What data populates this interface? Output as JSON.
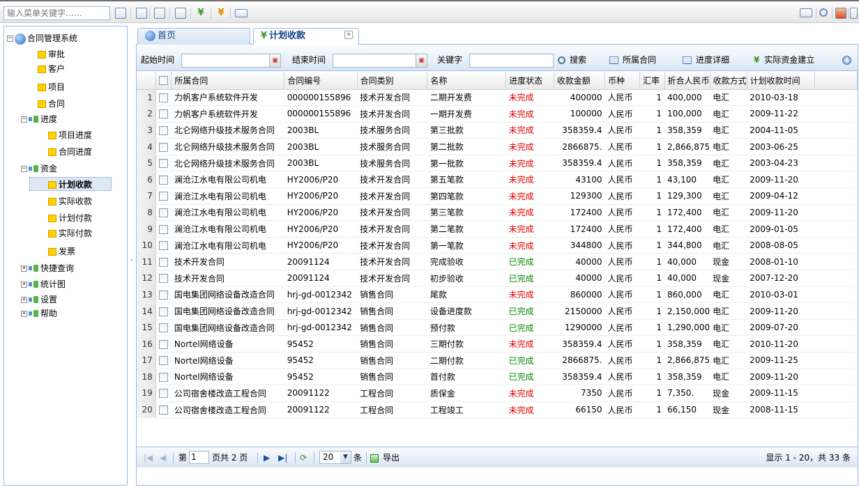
{
  "topbar": {
    "search_placeholder": "输入菜单关键字……",
    "icons": [
      "tree-expand-icon",
      "list-icon",
      "window-icon",
      "grid-icon",
      "yen-green-icon",
      "yen-orange-icon",
      "card-icon",
      "mail-icon",
      "search-icon",
      "save-icon",
      "layout-icon"
    ]
  },
  "tree": {
    "root": "合同管理系统",
    "items": [
      {
        "label": "审批",
        "level": 1
      },
      {
        "label": "客户",
        "level": 1
      },
      {
        "label": "项目",
        "level": 1
      },
      {
        "label": "合同",
        "level": 1
      },
      {
        "label": "进度",
        "level": 0,
        "expanded": true
      },
      {
        "label": "项目进度",
        "level": 1
      },
      {
        "label": "合同进度",
        "level": 1
      },
      {
        "label": "资金",
        "level": 0,
        "expanded": true
      },
      {
        "label": "计划收款",
        "level": 1,
        "selected": true
      },
      {
        "label": "实际收款",
        "level": 1
      },
      {
        "label": "计划付款",
        "level": 1
      },
      {
        "label": "实际付款",
        "level": 1
      },
      {
        "label": "发票",
        "level": 1
      },
      {
        "label": "快捷查询",
        "level": 0,
        "expanded": false
      },
      {
        "label": "统计图",
        "level": 0,
        "expanded": false
      },
      {
        "label": "设置",
        "level": 0,
        "expanded": false
      },
      {
        "label": "帮助",
        "level": 0,
        "expanded": false
      }
    ]
  },
  "tabs": {
    "home": "首页",
    "active": "计划收款"
  },
  "filter": {
    "start_label": "起始时间",
    "end_label": "结束时间",
    "keyword_label": "关键字",
    "search_btn": "搜索",
    "contract_btn": "所属合同",
    "progress_btn": "进度详细",
    "fund_btn": "实际资金建立"
  },
  "grid": {
    "columns": [
      "所属合同",
      "合同编号",
      "合同类别",
      "名称",
      "进度状态",
      "收款金额",
      "币种",
      "汇率",
      "折合人民币",
      "收款方式",
      "计划收款时间"
    ],
    "rows": [
      [
        "力帆客户系统软件开发",
        "000000155896",
        "技术开发合同",
        "二期开发费",
        "未完成",
        "400000",
        "人民币",
        "1",
        "400,000",
        "电汇",
        "2010-03-18"
      ],
      [
        "力帆客户系统软件开发",
        "000000155896",
        "技术开发合同",
        "一期开发费",
        "未完成",
        "100000",
        "人民币",
        "1",
        "100,000",
        "电汇",
        "2009-11-22"
      ],
      [
        "北仑网络升级技术服务合同",
        "2003BL",
        "技术服务合同",
        "第三批款",
        "未完成",
        "358359.4",
        "人民币",
        "1",
        "358,359",
        "电汇",
        "2004-11-05"
      ],
      [
        "北仑网络升级技术服务合同",
        "2003BL",
        "技术服务合同",
        "第二批款",
        "未完成",
        "2866875.",
        "人民币",
        "1",
        "2,866,875",
        "电汇",
        "2003-06-25"
      ],
      [
        "北仑网络升级技术服务合同",
        "2003BL",
        "技术服务合同",
        "第一批款",
        "未完成",
        "358359.4",
        "人民币",
        "1",
        "358,359",
        "电汇",
        "2003-04-23"
      ],
      [
        "澜沧江水电有限公司机电",
        "HY2006/P20",
        "技术开发合同",
        "第五笔款",
        "未完成",
        "43100",
        "人民币",
        "1",
        "43,100",
        "电汇",
        "2009-11-20"
      ],
      [
        "澜沧江水电有限公司机电",
        "HY2006/P20",
        "技术开发合同",
        "第四笔款",
        "未完成",
        "129300",
        "人民币",
        "1",
        "129,300",
        "电汇",
        "2009-04-12"
      ],
      [
        "澜沧江水电有限公司机电",
        "HY2006/P20",
        "技术开发合同",
        "第三笔款",
        "未完成",
        "172400",
        "人民币",
        "1",
        "172,400",
        "电汇",
        "2009-11-20"
      ],
      [
        "澜沧江水电有限公司机电",
        "HY2006/P20",
        "技术开发合同",
        "第二笔款",
        "未完成",
        "172400",
        "人民币",
        "1",
        "172,400",
        "电汇",
        "2009-01-05"
      ],
      [
        "澜沧江水电有限公司机电",
        "HY2006/P20",
        "技术开发合同",
        "第一笔款",
        "未完成",
        "344800",
        "人民币",
        "1",
        "344,800",
        "电汇",
        "2008-08-05"
      ],
      [
        "技术开发合同",
        "20091124",
        "技术开发合同",
        "完成验收",
        "已完成",
        "40000",
        "人民币",
        "1",
        "40,000",
        "现金",
        "2008-01-10"
      ],
      [
        "技术开发合同",
        "20091124",
        "技术开发合同",
        "初步验收",
        "已完成",
        "40000",
        "人民币",
        "1",
        "40,000",
        "现金",
        "2007-12-20"
      ],
      [
        "国电集团网络设备改造合同",
        "hrj-gd-0012342",
        "销售合同",
        "尾款",
        "未完成",
        "860000",
        "人民币",
        "1",
        "860,000",
        "电汇",
        "2010-03-01"
      ],
      [
        "国电集团网络设备改造合同",
        "hrj-gd-0012342",
        "销售合同",
        "设备进度款",
        "已完成",
        "2150000",
        "人民币",
        "1",
        "2,150,000",
        "电汇",
        "2009-11-20"
      ],
      [
        "国电集团网络设备改造合同",
        "hrj-gd-0012342",
        "销售合同",
        "预付款",
        "已完成",
        "1290000",
        "人民币",
        "1",
        "1,290,000",
        "电汇",
        "2009-07-20"
      ],
      [
        "Nortel网络设备",
        "95452",
        "销售合同",
        "三期付款",
        "未完成",
        "358359.4",
        "人民币",
        "1",
        "358,359",
        "电汇",
        "2010-11-20"
      ],
      [
        "Nortel网络设备",
        "95452",
        "销售合同",
        "二期付款",
        "已完成",
        "2866875.",
        "人民币",
        "1",
        "2,866,875",
        "电汇",
        "2009-11-25"
      ],
      [
        "Nortel网络设备",
        "95452",
        "销售合同",
        "首付款",
        "已完成",
        "358359.4",
        "人民币",
        "1",
        "358,359",
        "电汇",
        "2009-11-20"
      ],
      [
        "公司宿舍楼改造工程合同",
        "20091122",
        "工程合同",
        "质保金",
        "未完成",
        "7350",
        "人民币",
        "1",
        "7,350.",
        "现金",
        "2009-11-15"
      ],
      [
        "公司宿舍楼改造工程合同",
        "20091122",
        "工程合同",
        "工程竣工",
        "未完成",
        "66150",
        "人民币",
        "1",
        "66,150",
        "现金",
        "2008-11-15"
      ]
    ],
    "status_colors": {
      "未完成": "#e00000",
      "已完成": "#008800"
    }
  },
  "paging": {
    "page_prefix": "第",
    "current_page": "1",
    "page_suffix": "页共 2 页",
    "page_size": "20",
    "page_size_suffix": "条",
    "export": "导出",
    "summary": "显示 1 - 20，共 33 条"
  }
}
